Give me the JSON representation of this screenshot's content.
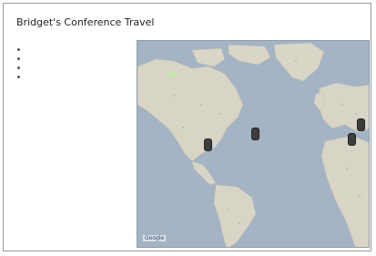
{
  "page": {
    "title": "Bridget's Conference Travel"
  },
  "nav": {
    "items": [
      {
        "label": "",
        "link": true
      },
      {
        "label": "",
        "link": false
      },
      {
        "label": "",
        "link": false
      },
      {
        "label": "",
        "link": false
      }
    ],
    "link_text": "",
    "static_text": ""
  },
  "map": {
    "credit": "Google",
    "terms": ""
  },
  "colors": {
    "water": "#a4b4c4",
    "land": "#d8d5c6"
  }
}
